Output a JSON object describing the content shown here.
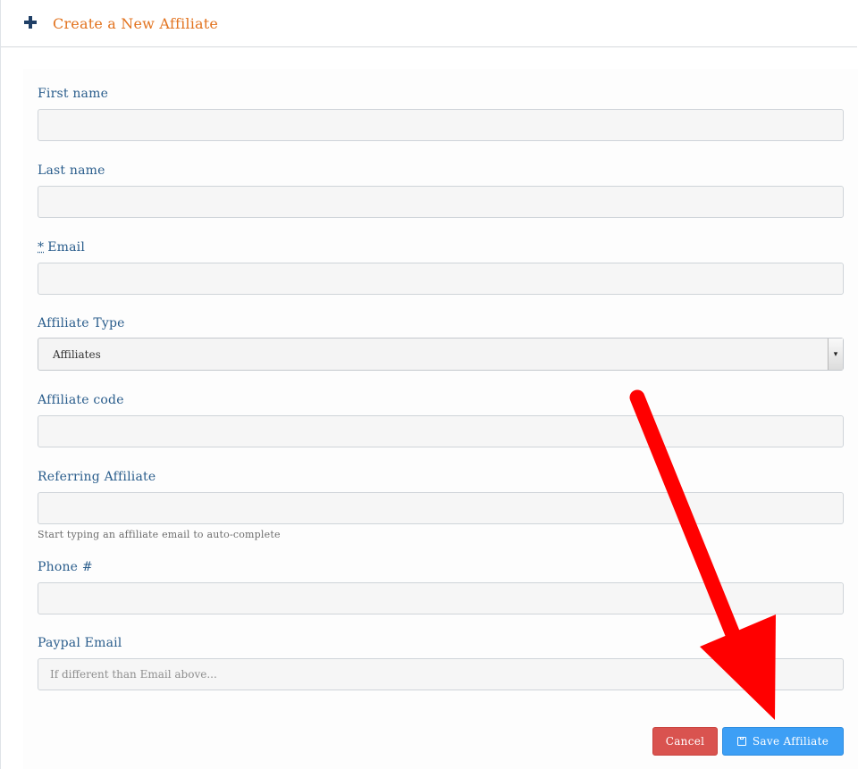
{
  "header": {
    "title": "Create a New Affiliate",
    "icon": "plus-icon"
  },
  "fields": {
    "first_name": {
      "label": "First name",
      "value": ""
    },
    "last_name": {
      "label": "Last name",
      "value": ""
    },
    "email": {
      "required_mark": "*",
      "label": "Email",
      "value": ""
    },
    "affiliate_type": {
      "label": "Affiliate Type",
      "selected": "Affiliates"
    },
    "affiliate_code": {
      "label": "Affiliate code",
      "value": ""
    },
    "referring_affiliate": {
      "label": "Referring Affiliate",
      "value": "",
      "help": "Start typing an affiliate email to auto-complete"
    },
    "phone": {
      "label": "Phone #",
      "value": ""
    },
    "paypal_email": {
      "label": "Paypal Email",
      "value": "",
      "placeholder": "If different than Email above..."
    }
  },
  "buttons": {
    "cancel": "Cancel",
    "save": "Save Affiliate",
    "save_icon": "floppy-icon"
  },
  "colors": {
    "title": "#e2731f",
    "label": "#2a5d8c",
    "cancel": "#d9534f",
    "save": "#3d9ff5",
    "annotation_arrow": "#ff0000"
  }
}
